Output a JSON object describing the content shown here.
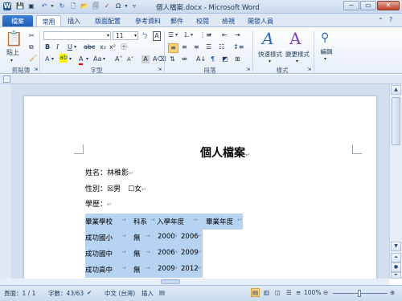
{
  "window": {
    "title": "個人檔案.docx - Microsoft Word",
    "minimize": "─",
    "maximize": "▭",
    "close": "✕"
  },
  "tabs": [
    {
      "label": "檔案"
    },
    {
      "label": "常用"
    },
    {
      "label": "插入"
    },
    {
      "label": "版面配置"
    },
    {
      "label": "參考資料"
    },
    {
      "label": "郵件"
    },
    {
      "label": "校閱"
    },
    {
      "label": "檢視"
    },
    {
      "label": "開發人員"
    }
  ],
  "ribbon": {
    "clipboard": {
      "label": "剪貼簿",
      "paste": "貼上"
    },
    "font": {
      "label": "字型",
      "font_name": "",
      "font_size": "11"
    },
    "paragraph": {
      "label": "段落"
    },
    "styles": {
      "label": "樣式",
      "quick_styles": "快速樣式",
      "change_styles": "變更樣式"
    },
    "editing": {
      "label": "編輯"
    }
  },
  "document": {
    "title": "個人檔案",
    "name_line": "姓名：林稚影",
    "gender_line": "性別：☒男　☐女",
    "education_line": "學歷：",
    "table": {
      "header": [
        "畢業學校",
        "科系",
        "入學年度",
        "畢業年度"
      ],
      "rows": [
        [
          "成功國小",
          "無",
          "2000",
          "2006"
        ],
        [
          "成功國中",
          "無",
          "2006",
          "2009"
        ],
        [
          "成功高中",
          "無",
          "2009",
          "2012"
        ]
      ]
    }
  },
  "status": {
    "page": "頁面：1 / 1",
    "words": "字數：43/63",
    "language": "中文 (台灣)",
    "mode": "插入",
    "zoom": "100%",
    "zoom_minus": "⊖",
    "zoom_plus": "⊕"
  }
}
